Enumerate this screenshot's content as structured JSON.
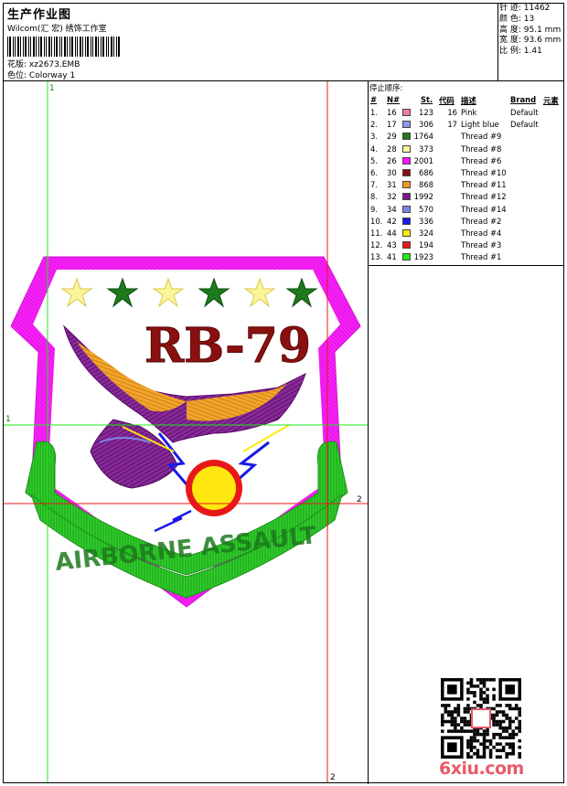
{
  "header": {
    "title": "生产作业图",
    "subtitle": "Wilcom(汇 宏) 绣饰工作室",
    "design_file_label": "花版:",
    "design_file": "xz2673.EMB",
    "colorway_label": "色位:",
    "colorway": "Colorway 1"
  },
  "stats": [
    {
      "label": "针 迹:",
      "value": "11462"
    },
    {
      "label": "颜 色:",
      "value": "13"
    },
    {
      "label": "高 度:",
      "value": "95.1 mm"
    },
    {
      "label": "宽 度:",
      "value": "93.6 mm"
    },
    {
      "label": "比 例:",
      "value": "1.41"
    }
  ],
  "design": {
    "text_top": "RB-79",
    "text_banner": "AIRBORNE ASSAULT",
    "marker_1": "1",
    "marker_2": "2"
  },
  "thread_panel": {
    "title": "停止顺序:",
    "columns": [
      "#",
      "N#",
      "St.",
      "代码",
      "描述",
      "Brand",
      "元素"
    ],
    "rows": [
      {
        "n": "1.",
        "nn": "16",
        "color": "#f07aa8",
        "st": "123",
        "code": "16",
        "desc": "Pink",
        "brand": "Default"
      },
      {
        "n": "2.",
        "nn": "17",
        "color": "#8c9ae8",
        "st": "306",
        "code": "17",
        "desc": "Light blue",
        "brand": "Default"
      },
      {
        "n": "3.",
        "nn": "29",
        "color": "#1d7a1d",
        "st": "1764",
        "code": "",
        "desc": "Thread #9",
        "brand": ""
      },
      {
        "n": "4.",
        "nn": "28",
        "color": "#fbf59a",
        "st": "373",
        "code": "",
        "desc": "Thread #8",
        "brand": ""
      },
      {
        "n": "5.",
        "nn": "26",
        "color": "#ff10ff",
        "st": "2001",
        "code": "",
        "desc": "Thread #6",
        "brand": ""
      },
      {
        "n": "6.",
        "nn": "30",
        "color": "#8a1010",
        "st": "686",
        "code": "",
        "desc": "Thread #10",
        "brand": ""
      },
      {
        "n": "7.",
        "nn": "31",
        "color": "#f09a1a",
        "st": "868",
        "code": "",
        "desc": "Thread #11",
        "brand": ""
      },
      {
        "n": "8.",
        "nn": "32",
        "color": "#7a1a8a",
        "st": "1992",
        "code": "",
        "desc": "Thread #12",
        "brand": ""
      },
      {
        "n": "9.",
        "nn": "34",
        "color": "#7b86e8",
        "st": "570",
        "code": "",
        "desc": "Thread #14",
        "brand": ""
      },
      {
        "n": "10.",
        "nn": "42",
        "color": "#1818e8",
        "st": "336",
        "code": "",
        "desc": "Thread #2",
        "brand": ""
      },
      {
        "n": "11.",
        "nn": "44",
        "color": "#ffe810",
        "st": "324",
        "code": "",
        "desc": "Thread #4",
        "brand": ""
      },
      {
        "n": "12.",
        "nn": "43",
        "color": "#e81818",
        "st": "194",
        "code": "",
        "desc": "Thread #3",
        "brand": ""
      },
      {
        "n": "13.",
        "nn": "41",
        "color": "#22e81a",
        "st": "1923",
        "code": "",
        "desc": "Thread #1",
        "brand": ""
      }
    ]
  },
  "watermark": {
    "site": "6xiu.com"
  }
}
